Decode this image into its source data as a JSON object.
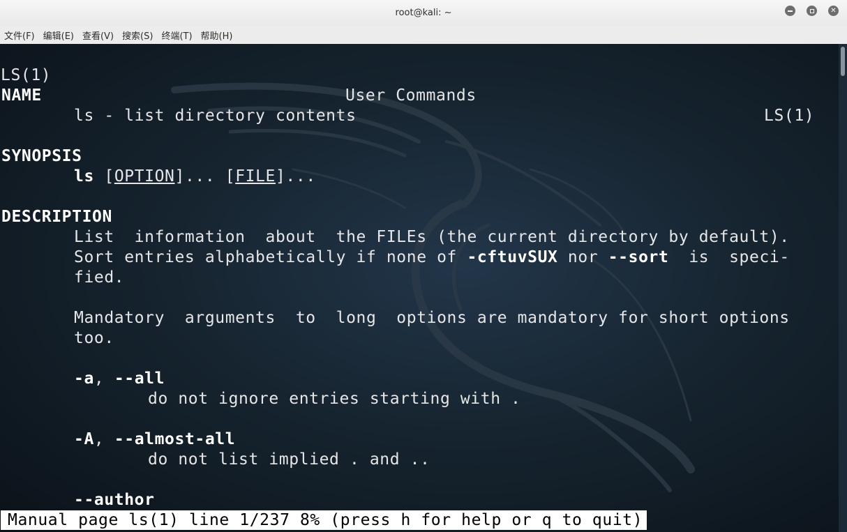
{
  "window": {
    "title": "root@kali: ~"
  },
  "menu": {
    "items": [
      "文件(F)",
      "编辑(E)",
      "查看(V)",
      "搜索(S)",
      "终端(T)",
      "帮助(H)"
    ]
  },
  "man": {
    "header_left": "LS(1)",
    "header_center": "User Commands",
    "header_right": "LS(1)",
    "name_heading": "NAME",
    "name_text": "ls - list directory contents",
    "synopsis_heading": "SYNOPSIS",
    "synopsis_cmd": "ls",
    "synopsis_option": "OPTION",
    "synopsis_file": "FILE",
    "description_heading": "DESCRIPTION",
    "desc_line1": "List  information  about  the FILEs (the current directory by default).",
    "desc_line2_pre": "Sort entries alphabetically if none of ",
    "desc_line2_flag1": "-cftuvSUX",
    "desc_line2_mid": " nor ",
    "desc_line2_flag2": "--sort",
    "desc_line2_post": "  is  speci-",
    "desc_line3": "fied.",
    "mandatory_line1": "Mandatory  arguments  to  long  options are mandatory for short options",
    "mandatory_line2": "too.",
    "opt_a_short": "-a",
    "opt_a_long": "--all",
    "opt_a_desc": "do not ignore entries starting with .",
    "opt_A_short": "-A",
    "opt_A_long": "--almost-all",
    "opt_A_desc": "do not list implied . and ..",
    "opt_author": "--author"
  },
  "status": {
    "text": "Manual page ls(1) line 1/237 8% (press h for help or q to quit)"
  },
  "colors": {
    "terminal_bg": "#16242f",
    "text": "#e6e6e6",
    "bold_text": "#ffffff",
    "status_bg": "#ffffff"
  }
}
